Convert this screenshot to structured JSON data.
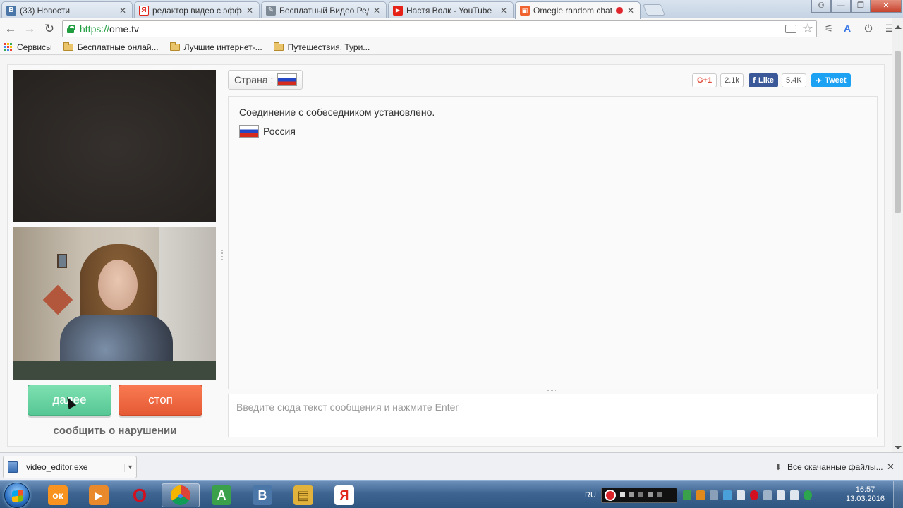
{
  "tabs": [
    {
      "title": "(33) Новости",
      "favicon": "vk-icon",
      "favicon_letter": "В",
      "favicon_color": "#4a76a8",
      "active": false
    },
    {
      "title": "редактор видео с эффекта",
      "favicon": "yandex-icon",
      "favicon_letter": "Я",
      "favicon_color": "#e1261c",
      "active": false
    },
    {
      "title": "Бесплатный Видео Редак",
      "favicon": "video-editor-icon",
      "favicon_letter": "✎",
      "favicon_color": "#7d8a96",
      "active": false
    },
    {
      "title": "Настя Волк - YouTube",
      "favicon": "youtube-icon",
      "favicon_letter": "▶",
      "favicon_color": "#e62117",
      "active": false
    },
    {
      "title": "Omegle random chat a",
      "favicon": "ometv-icon",
      "favicon_letter": "▣",
      "favicon_color": "#f0622e",
      "active": true
    }
  ],
  "window_controls": {
    "minimize": "—",
    "maximize": "❐",
    "close": "✕",
    "profile": "⚇"
  },
  "address_bar": {
    "scheme": "https://",
    "host": "ome.tv"
  },
  "nav": {
    "back": "←",
    "forward": "→",
    "reload": "↻"
  },
  "bookmarks": {
    "apps_label": "Сервисы",
    "items": [
      "Бесплатные онлай...",
      "Лучшие интернет-...",
      "Путешествия, Тури..."
    ]
  },
  "page": {
    "country_label": "Страна :",
    "next_button": "далее",
    "stop_button": "стоп",
    "report_link": "сообщить о нарушении",
    "social": {
      "gplus_label": "G+1",
      "gplus_count": "2.1k",
      "like_label": "Like",
      "like_count": "5.4K",
      "tweet_label": "Tweet"
    },
    "chat": {
      "status_message": "Соединение с собеседником установлено.",
      "partner_country": "Россия"
    },
    "message_placeholder": "Введите сюда текст сообщения и нажмите Enter"
  },
  "download_shelf": {
    "file_name": "video_editor.exe",
    "all_downloads": "Все скачанные файлы...",
    "close": "✕"
  },
  "taskbar": {
    "apps": [
      {
        "name": "odnoklassniki",
        "glyph": "ок",
        "color": "#f7931e"
      },
      {
        "name": "media-player",
        "glyph": "▶",
        "color": "#e8892c"
      },
      {
        "name": "opera",
        "glyph": "O",
        "color": "#d3101f"
      },
      {
        "name": "chrome",
        "glyph": "●",
        "color": "#db4437"
      },
      {
        "name": "vk-app-green",
        "glyph": "A",
        "color": "#3aa04a"
      },
      {
        "name": "vk-app",
        "glyph": "B",
        "color": "#4a76a8"
      },
      {
        "name": "explorer",
        "glyph": "▤",
        "color": "#e2b33c"
      },
      {
        "name": "yandex-browser",
        "glyph": "Я",
        "color": "#e1261c"
      }
    ],
    "language": "RU",
    "time": "16:57",
    "date": "13.03.2016"
  },
  "colors": {
    "next": "#62d19f",
    "stop": "#f06a42",
    "facebook": "#3b5998",
    "twitter": "#1da1f2",
    "gplus": "#dd4b39"
  }
}
